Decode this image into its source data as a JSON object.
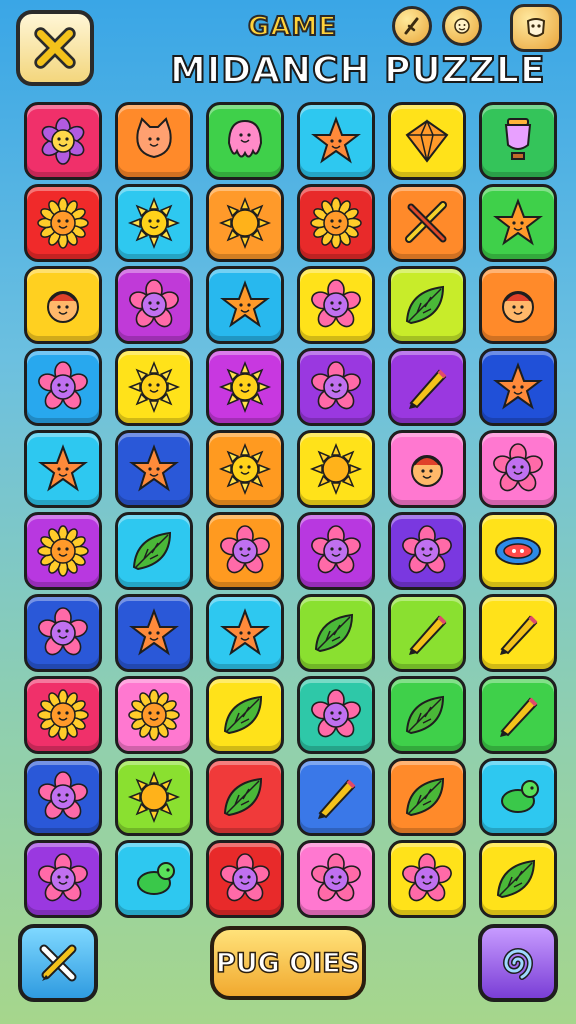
{
  "header": {
    "title_small": "GAME",
    "title_big": "MIDANCH PUZZLE",
    "close_icon": "close-x-icon",
    "buttons": [
      {
        "name": "sword-icon"
      },
      {
        "name": "face-icon"
      },
      {
        "name": "mask-icon"
      }
    ]
  },
  "board": {
    "rows": 10,
    "cols": 6,
    "tiles": [
      [
        "#f0306a",
        "flower"
      ],
      [
        "#ff8a2a",
        "cat"
      ],
      [
        "#3fd04a",
        "octopus"
      ],
      [
        "#2ec8f0",
        "star-face"
      ],
      [
        "#ffe21a",
        "gem"
      ],
      [
        "#34c45a",
        "trophy"
      ],
      [
        "#f02a2a",
        "sunflower"
      ],
      [
        "#2ec8f0",
        "sun-face"
      ],
      [
        "#ff9a2a",
        "sun"
      ],
      [
        "#e82a2a",
        "sunflower"
      ],
      [
        "#ff8a2a",
        "pencil-cross"
      ],
      [
        "#3fd04a",
        "star"
      ],
      [
        "#ffd020",
        "face"
      ],
      [
        "#c03ad8",
        "flower-face"
      ],
      [
        "#28b8ee",
        "star"
      ],
      [
        "#ffe21a",
        "flower-face"
      ],
      [
        "#c8ec2a",
        "leaf"
      ],
      [
        "#ff8a2a",
        "face"
      ],
      [
        "#28a8ee",
        "flower-face"
      ],
      [
        "#ffe21a",
        "sun-face"
      ],
      [
        "#c838e0",
        "sun-face"
      ],
      [
        "#9a38e0",
        "flower-face"
      ],
      [
        "#9a38e0",
        "pencil"
      ],
      [
        "#2050d8",
        "star-face"
      ],
      [
        "#2ec8f0",
        "star-face"
      ],
      [
        "#2a58d8",
        "star-face"
      ],
      [
        "#ff9a20",
        "sun-face"
      ],
      [
        "#ffe21a",
        "sun"
      ],
      [
        "#ff78d0",
        "face"
      ],
      [
        "#ff78d0",
        "flower-face"
      ],
      [
        "#b838e0",
        "sunflower"
      ],
      [
        "#2ec8f0",
        "leaf"
      ],
      [
        "#ff9a20",
        "flower-face"
      ],
      [
        "#b838e0",
        "flower-face"
      ],
      [
        "#7a38e0",
        "flower-face"
      ],
      [
        "#ffe21a",
        "candy"
      ],
      [
        "#2a58d8",
        "flower-face"
      ],
      [
        "#2a58d8",
        "star-face"
      ],
      [
        "#2ec8f0",
        "star-face"
      ],
      [
        "#8ae030",
        "leaf"
      ],
      [
        "#8ae030",
        "pencil"
      ],
      [
        "#ffe21a",
        "pencil"
      ],
      [
        "#f0306a",
        "sunflower"
      ],
      [
        "#ff78d0",
        "sunflower"
      ],
      [
        "#ffe21a",
        "leaf"
      ],
      [
        "#2ec8a8",
        "flower-face"
      ],
      [
        "#3fd04a",
        "leaf"
      ],
      [
        "#3fd04a",
        "pencil"
      ],
      [
        "#2a58d8",
        "flower-face"
      ],
      [
        "#8ae030",
        "sun"
      ],
      [
        "#f03a3a",
        "leaf"
      ],
      [
        "#3a78e8",
        "pencil"
      ],
      [
        "#ff8a2a",
        "leaf"
      ],
      [
        "#2ec8f0",
        "turtle"
      ],
      [
        "#9a38e0",
        "flower-face"
      ],
      [
        "#2ec8f0",
        "turtle"
      ],
      [
        "#e82a2a",
        "flower-face"
      ],
      [
        "#ff78d0",
        "flower-face"
      ],
      [
        "#ffe21a",
        "flower-face"
      ],
      [
        "#ffe21a",
        "leaf"
      ]
    ]
  },
  "footer": {
    "main_button_label": "PUG OIES",
    "left_icon": "pencil-cross-icon",
    "right_icon": "swirl-icon"
  }
}
